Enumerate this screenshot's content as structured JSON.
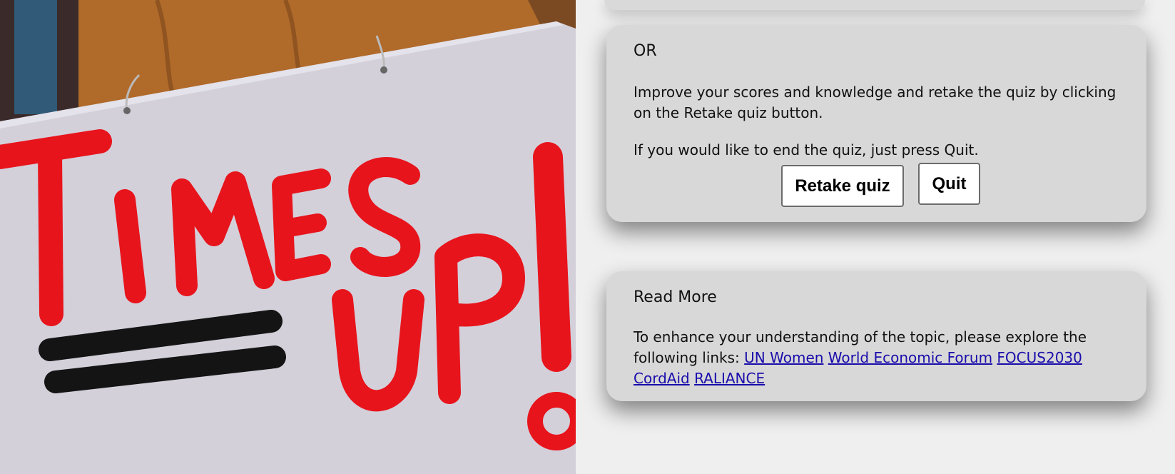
{
  "photo": {
    "sign_text_line1": "TIMES",
    "sign_text_line2": "UP!",
    "sign_color": "#e8141c",
    "sign_background": "#d3d0da"
  },
  "or_card": {
    "heading": "OR",
    "improve_text": "Improve your scores and knowledge and retake the quiz by clicking on the Retake quiz button.",
    "quit_text": "If you would like to end the quiz, just press Quit.",
    "retake_label": "Retake quiz",
    "quit_label": "Quit"
  },
  "read_more_card": {
    "heading": "Read More",
    "intro_text": "To enhance your understanding of the topic, please explore the following links:",
    "links": [
      {
        "label": "UN Women"
      },
      {
        "label": "World Economic Forum"
      },
      {
        "label": "FOCUS2030"
      },
      {
        "label": "CordAid"
      },
      {
        "label": "RALIANCE"
      }
    ]
  },
  "colors": {
    "card_bg": "#d8d8d8",
    "page_bg": "#efefef",
    "link": "#1a0dab"
  }
}
